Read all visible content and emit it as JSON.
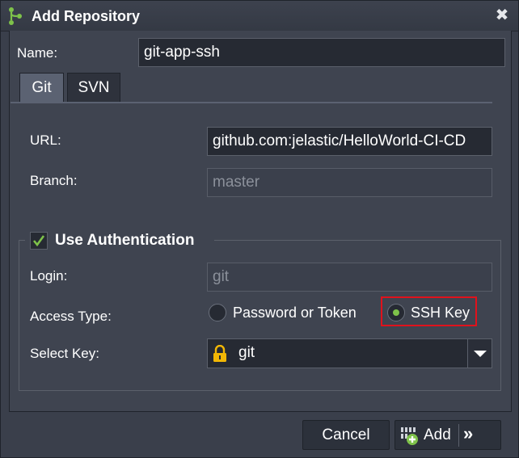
{
  "dialog": {
    "title": "Add Repository",
    "icons": {
      "title": "git-branch-icon",
      "close": "close-icon"
    },
    "close_glyph": "✖"
  },
  "form": {
    "name_label": "Name:",
    "name_value": "git-app-ssh"
  },
  "tabs": [
    {
      "label": "Git",
      "active": true
    },
    {
      "label": "SVN",
      "active": false
    }
  ],
  "git": {
    "url_label": "URL:",
    "url_value": "github.com:jelastic/HelloWorld-CI-CD",
    "branch_label": "Branch:",
    "branch_value": "master"
  },
  "auth": {
    "enabled": true,
    "title": "Use Authentication",
    "login_label": "Login:",
    "login_value": "git",
    "access_type_label": "Access Type:",
    "options": [
      {
        "label": "Password or Token",
        "selected": false
      },
      {
        "label": "SSH Key",
        "selected": true
      }
    ],
    "select_key_label": "Select Key:",
    "select_key_value": "git",
    "select_icon": "lock-icon"
  },
  "buttons": {
    "cancel": "Cancel",
    "add": "Add",
    "more_glyph": "»"
  },
  "colors": {
    "accent": "#7ec24a",
    "highlight": "#e0121c",
    "lock": "#f2b705"
  }
}
